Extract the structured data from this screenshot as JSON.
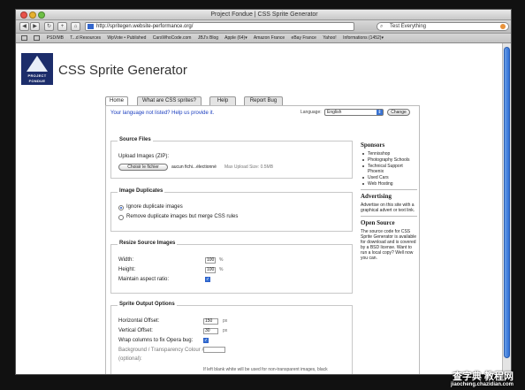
{
  "window": {
    "title": "Project Fondue | CSS Sprite Generator"
  },
  "browser": {
    "url": "http://spritegen.website-performance.org/",
    "search_value": "Test Everything",
    "bookmarks": [
      "PSD/MB",
      "T...d Resources",
      "WpVote • Published",
      "CarsWhoCode.com",
      "JBJ's Blog",
      "Apple (64)▾",
      "Amazon France",
      "eBay France",
      "Yahoo!",
      "Informations (1452)▾"
    ]
  },
  "logo": {
    "line1": "PROJECT",
    "line2": "FONDUE"
  },
  "app_title": "CSS Sprite Generator",
  "tabs": [
    {
      "label": "Home",
      "active": true
    },
    {
      "label": "What are CSS sprites?"
    },
    {
      "label": "Help"
    },
    {
      "label": "Report Bug"
    }
  ],
  "language": {
    "prompt": "Your language not listed? Help us provide it.",
    "label": "Language:",
    "selected": "English",
    "change_label": "Change"
  },
  "source_files": {
    "legend": "Source Files",
    "upload_label": "Upload Images (ZIP):",
    "choose_label": "Choisir le fichier",
    "file_status": "aucun fichi...électionné",
    "max_size": "Max Upload Size: 0.5MB"
  },
  "duplicates": {
    "legend": "Image Duplicates",
    "options": [
      "Ignore duplicate images",
      "Remove duplicate images but merge CSS rules"
    ],
    "selected_index": 0
  },
  "resize": {
    "legend": "Resize Source Images",
    "width_label": "Width:",
    "width_value": "100",
    "width_unit": "%",
    "height_label": "Height:",
    "height_value": "100",
    "height_unit": "%",
    "aspect_label": "Maintain aspect ratio:",
    "aspect_checked": true
  },
  "output": {
    "legend": "Sprite Output Options",
    "hoffset_label": "Horizontal Offset:",
    "hoffset_value": "150",
    "hoffset_unit": "px",
    "voffset_label": "Vertical Offset:",
    "voffset_value": "30",
    "voffset_unit": "px",
    "wrap_label": "Wrap columns to fix Opera bug:",
    "wrap_checked": true,
    "bg_label": "Background / Transparency Colour #",
    "bg_optional": "(optional):",
    "bg_hint": "If left blank white will be used for non-transparent images, black"
  },
  "sidebar": {
    "sponsors_title": "Sponsors",
    "sponsors": [
      "Tennisshop",
      "Photography Schools",
      "Technical Support Phoenix",
      "Used Cars",
      "Web Hosting"
    ],
    "advertising_title": "Advertising",
    "advertising_text": "Advertise on this site with a graphical advert or text link.",
    "opensource_title": "Open Source",
    "opensource_text": "The source code for CSS Sprite Generator is available for download and is covered by a BSD license. Want to run a local copy? Well now you can."
  },
  "watermark": {
    "line1": "查字典 教程网",
    "line2": "jiaocheng.chazidian.com"
  }
}
